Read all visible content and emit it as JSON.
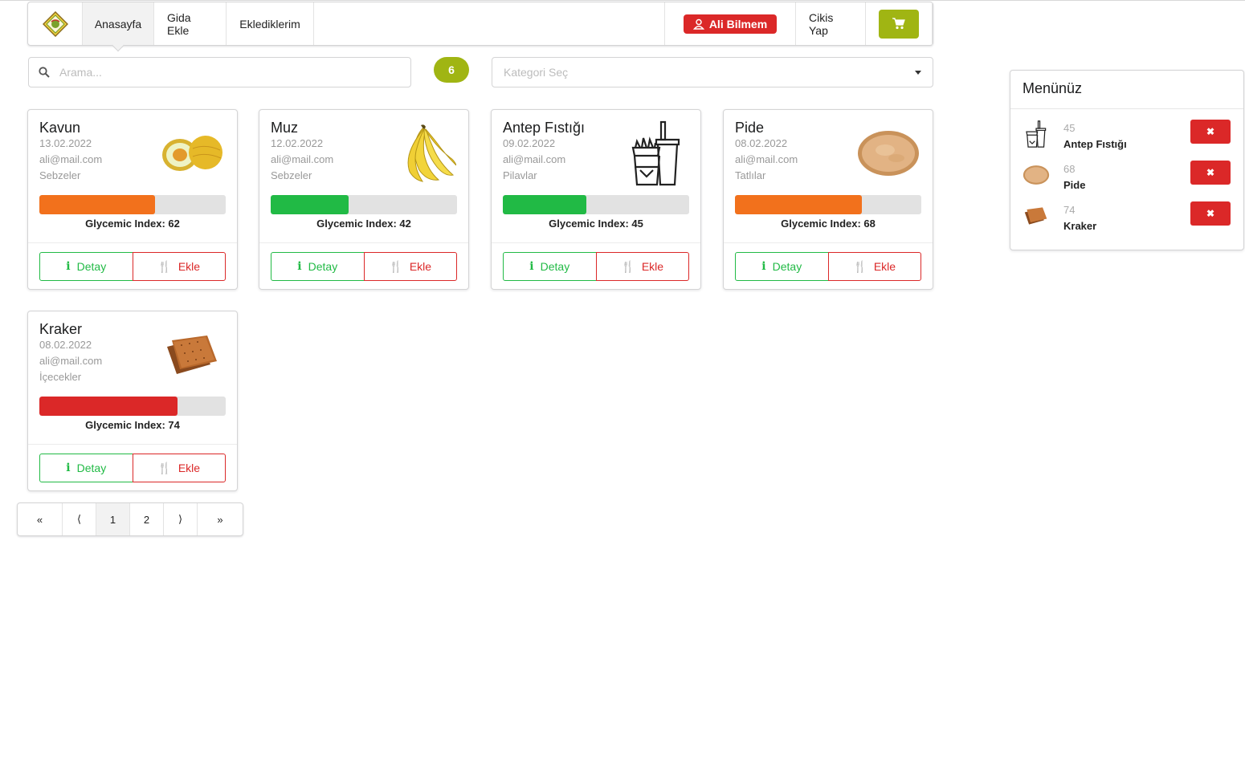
{
  "nav": {
    "home": "Anasayfa",
    "add_food": "Gida Ekle",
    "my_added": "Eklediklerim",
    "user": "Ali Bilmem",
    "logout": "Cikis Yap"
  },
  "search": {
    "placeholder": "Arama..."
  },
  "count": "6",
  "category": {
    "placeholder": "Kategori Seç"
  },
  "cards": [
    {
      "title": "Kavun",
      "date": "13.02.2022",
      "email": "ali@mail.com",
      "category": "Sebzeler",
      "gi_label": "Glycemic Index: 62",
      "gi": 62,
      "bar_color": "#f2711c",
      "image": "melon-image"
    },
    {
      "title": "Muz",
      "date": "12.02.2022",
      "email": "ali@mail.com",
      "category": "Sebzeler",
      "gi_label": "Glycemic Index: 42",
      "gi": 42,
      "bar_color": "#21ba45",
      "image": "banana-image"
    },
    {
      "title": "Antep Fıstığı",
      "date": "09.02.2022",
      "email": "ali@mail.com",
      "category": "Pilavlar",
      "gi_label": "Glycemic Index: 45",
      "gi": 45,
      "bar_color": "#21ba45",
      "image": "fastfood-icon"
    },
    {
      "title": "Pide",
      "date": "08.02.2022",
      "email": "ali@mail.com",
      "category": "Tatlılar",
      "gi_label": "Glycemic Index: 68",
      "gi": 68,
      "bar_color": "#f2711c",
      "image": "bread-image"
    },
    {
      "title": "Kraker",
      "date": "08.02.2022",
      "email": "ali@mail.com",
      "category": "İçecekler",
      "gi_label": "Glycemic Index: 74",
      "gi": 74,
      "bar_color": "#db2828",
      "image": "cracker-image"
    }
  ],
  "card_buttons": {
    "detail": "Detay",
    "add": "Ekle"
  },
  "pagination": {
    "first": "«",
    "prev": "⟨",
    "pages": [
      "1",
      "2"
    ],
    "next": "⟩",
    "last": "»",
    "active_page": "1"
  },
  "menu_panel": {
    "title": "Menünüz",
    "items": [
      {
        "gi": "45",
        "name": "Antep Fıstığı",
        "image": "fastfood-icon"
      },
      {
        "gi": "68",
        "name": "Pide",
        "image": "bread-image"
      },
      {
        "gi": "74",
        "name": "Kraker",
        "image": "cracker-image"
      }
    ],
    "remove_label": "✖"
  },
  "colors": {
    "accent": "#a0b513",
    "danger": "#db2828",
    "success": "#21ba45",
    "warning": "#f2711c"
  }
}
